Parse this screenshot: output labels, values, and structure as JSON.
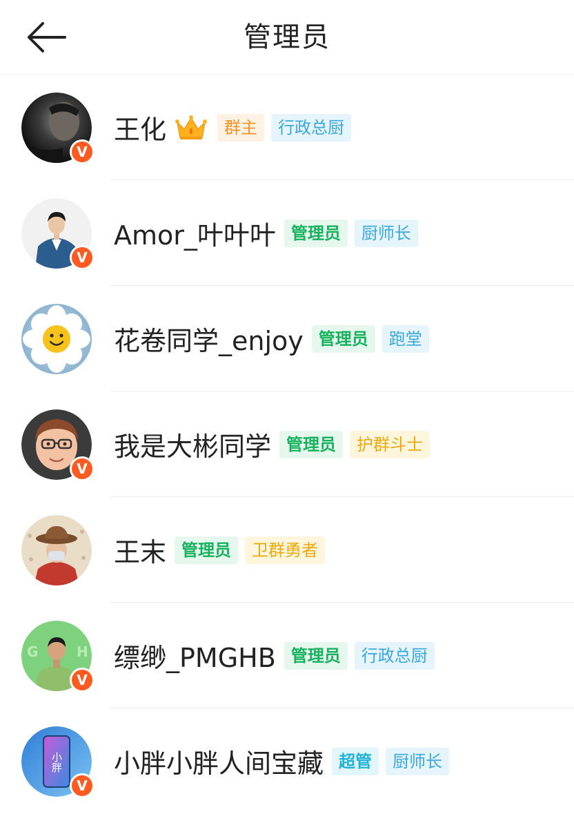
{
  "header": {
    "back_icon": "arrow-left-icon",
    "title": "管理员"
  },
  "colors": {
    "badge_orange": "#ff5a1f",
    "tag_green_text": "#17b25e",
    "tag_blue_text": "#3aa8e0",
    "tag_orange_text": "#f39426",
    "tag_yellow_text": "#ecaa0e",
    "tag_cyan_text": "#1fb3d8"
  },
  "members": [
    {
      "name": "王化",
      "crown": true,
      "verified_badge": "V",
      "tag1": "群主",
      "tag2": "行政总厨"
    },
    {
      "name": "Amor_叶叶叶",
      "verified_badge": "V",
      "tag1": "管理员",
      "tag2": "厨师长"
    },
    {
      "name": "花卷同学_enjoy",
      "tag1": "管理员",
      "tag2": "跑堂"
    },
    {
      "name": "我是大彬同学",
      "verified_badge": "V",
      "tag1": "管理员",
      "tag2": "护群斗士"
    },
    {
      "name": "王末",
      "tag1": "管理员",
      "tag2": "卫群勇者"
    },
    {
      "name": "缥缈_PMGHB",
      "verified_badge": "V",
      "tag1": "管理员",
      "tag2": "行政总厨"
    },
    {
      "name": "小胖小胖人间宝藏",
      "verified_badge": "V",
      "avatar_text": "小胖",
      "tag1": "超管",
      "tag2": "厨师长"
    }
  ]
}
